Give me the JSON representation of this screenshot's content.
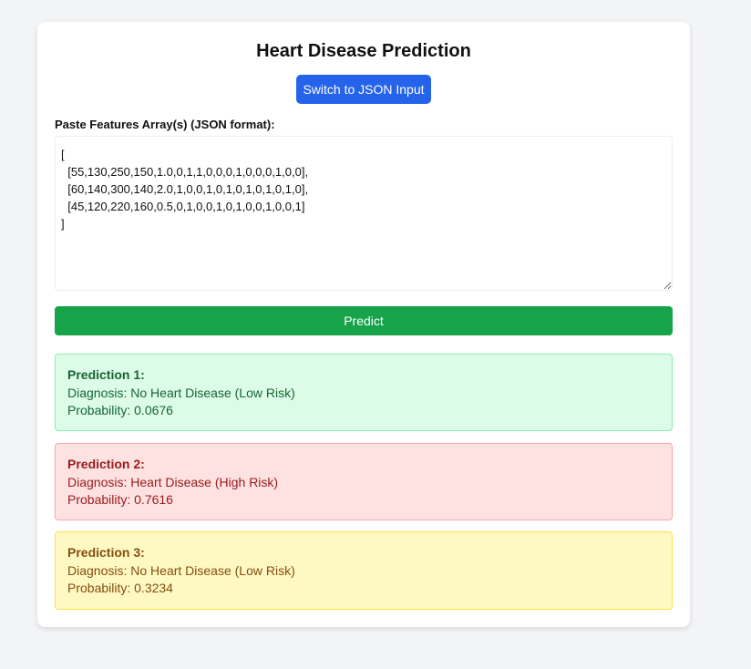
{
  "page": {
    "title": "Heart Disease Prediction",
    "switch_button_label": "Switch to JSON Input",
    "input_label": "Paste Features Array(s) (JSON format):",
    "input_value": "[\n  [55,130,250,150,1.0,0,1,1,0,0,0,1,0,0,0,1,0,0],\n  [60,140,300,140,2.0,1,0,0,1,0,1,0,1,0,1,0,1,0],\n  [45,120,220,160,0.5,0,1,0,0,1,0,1,0,0,1,0,0,1]\n]",
    "predict_button_label": "Predict"
  },
  "results": [
    {
      "title": "Prediction 1:",
      "diagnosis": "Diagnosis: No Heart Disease (Low Risk)",
      "probability": "Probability: 0.0676",
      "status_color": "#dcfce7"
    },
    {
      "title": "Prediction 2:",
      "diagnosis": "Diagnosis: Heart Disease (High Risk)",
      "probability": "Probability: 0.7616",
      "status_color": "#fee2e2"
    },
    {
      "title": "Prediction 3:",
      "diagnosis": "Diagnosis: No Heart Disease (Low Risk)",
      "probability": "Probability: 0.3234",
      "status_color": "#fef9c3"
    }
  ],
  "colors": {
    "switch_button": "#2563eb",
    "predict_button": "#16a34a",
    "background": "#f3f4f6"
  }
}
